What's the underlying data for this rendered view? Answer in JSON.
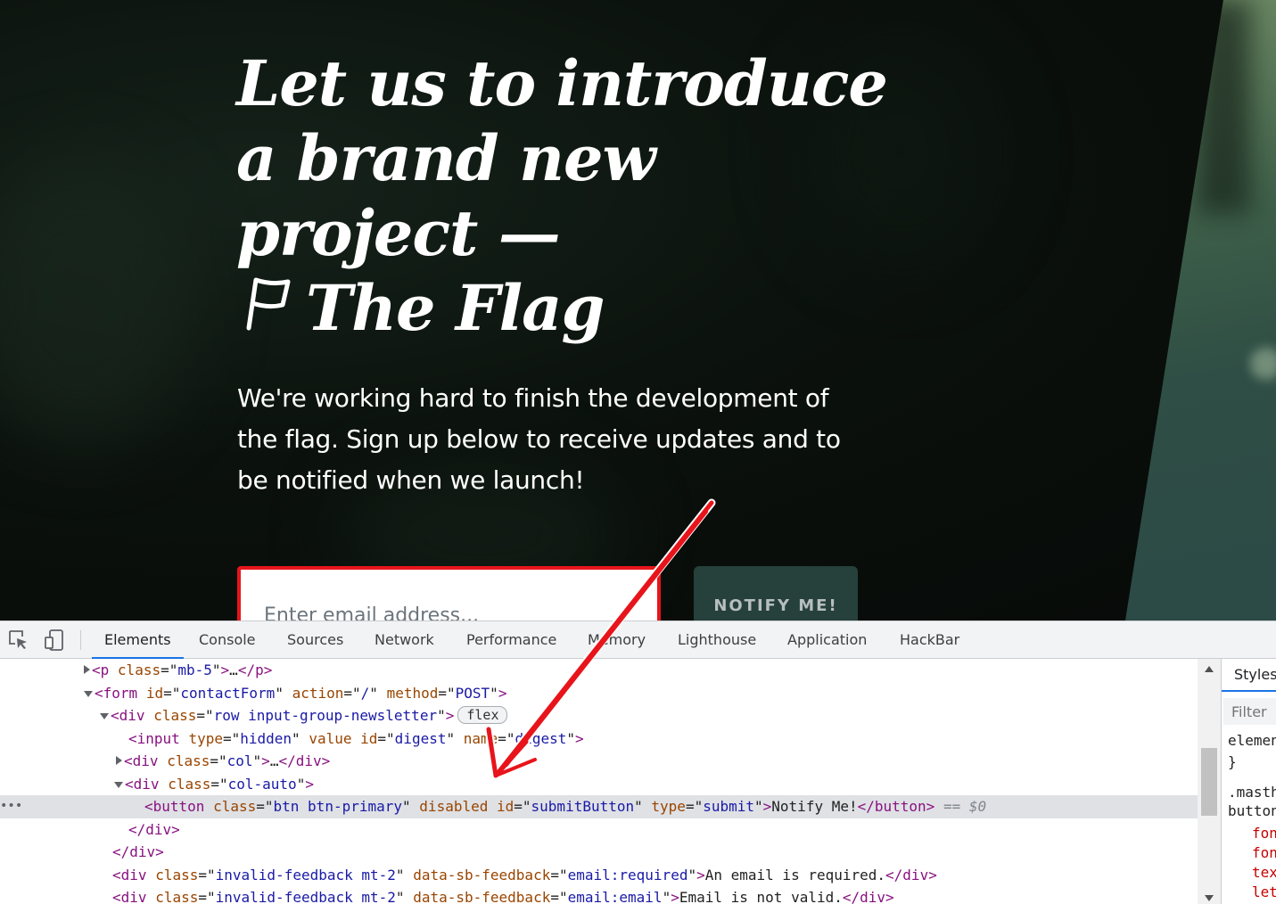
{
  "page": {
    "headline": {
      "line1": "Let us to introduce",
      "line2": "a brand new",
      "line3": "project —",
      "line4": "The Flag"
    },
    "lead": "We're working hard to finish the development of the flag. Sign up below to receive updates and to be notified when we launch!",
    "email_placeholder": "Enter email address...",
    "notify_button": "NOTIFY ME!",
    "colors": {
      "accent_red": "#e8141b",
      "button_bg": "#26403b"
    }
  },
  "devtools": {
    "tabs": [
      "Elements",
      "Console",
      "Sources",
      "Network",
      "Performance",
      "Memory",
      "Lighthouse",
      "Application",
      "HackBar"
    ],
    "active_tab": "Elements",
    "dom": {
      "l1": {
        "tag": "p",
        "attr1_name": "class",
        "attr1_value": "mb-5",
        "ellipsis": "…"
      },
      "l2": {
        "tag": "form",
        "id_name": "id",
        "id_value": "contactForm",
        "action_name": "action",
        "action_value": "/",
        "method_name": "method",
        "method_value": "POST"
      },
      "l3": {
        "tag": "div",
        "class_name": "class",
        "class_value": "row input-group-newsletter",
        "badge": "flex"
      },
      "l4": {
        "tag": "input",
        "type_name": "type",
        "type_value": "hidden",
        "value_name": "value",
        "id_name": "id",
        "id_value": "digest",
        "name_name": "name",
        "name_value": "digest"
      },
      "l5": {
        "tag": "div",
        "class_name": "class",
        "class_value": "col",
        "ellipsis": "…"
      },
      "l6": {
        "tag": "div",
        "class_name": "class",
        "class_value": "col-auto"
      },
      "l7": {
        "tag": "button",
        "class_name": "class",
        "class_value": "btn btn-primary",
        "disabled": "disabled",
        "id_name": "id",
        "id_value": "submitButton",
        "type_name": "type",
        "type_value": "submit",
        "text": "Notify Me!",
        "suffix": "== $0"
      },
      "l8": {
        "close": "div"
      },
      "l9": {
        "close": "div"
      },
      "l10": {
        "tag": "div",
        "class_name": "class",
        "class_value": "invalid-feedback mt-2",
        "data_name": "data-sb-feedback",
        "data_value": "email:required",
        "text": "An email is required."
      },
      "l11": {
        "tag": "div",
        "class_name": "class",
        "class_value": "invalid-feedback mt-2",
        "data_name": "data-sb-feedback",
        "data_value": "email:email",
        "text": "Email is not valid."
      }
    },
    "styles": {
      "tab": "Styles",
      "filter_placeholder": "Filter",
      "line1": "elemen",
      "line2": "}",
      "line3": ".masth",
      "line4": "button",
      "prop1": "fon",
      "prop2": "fon",
      "prop3": "tex",
      "prop4": "let"
    }
  }
}
